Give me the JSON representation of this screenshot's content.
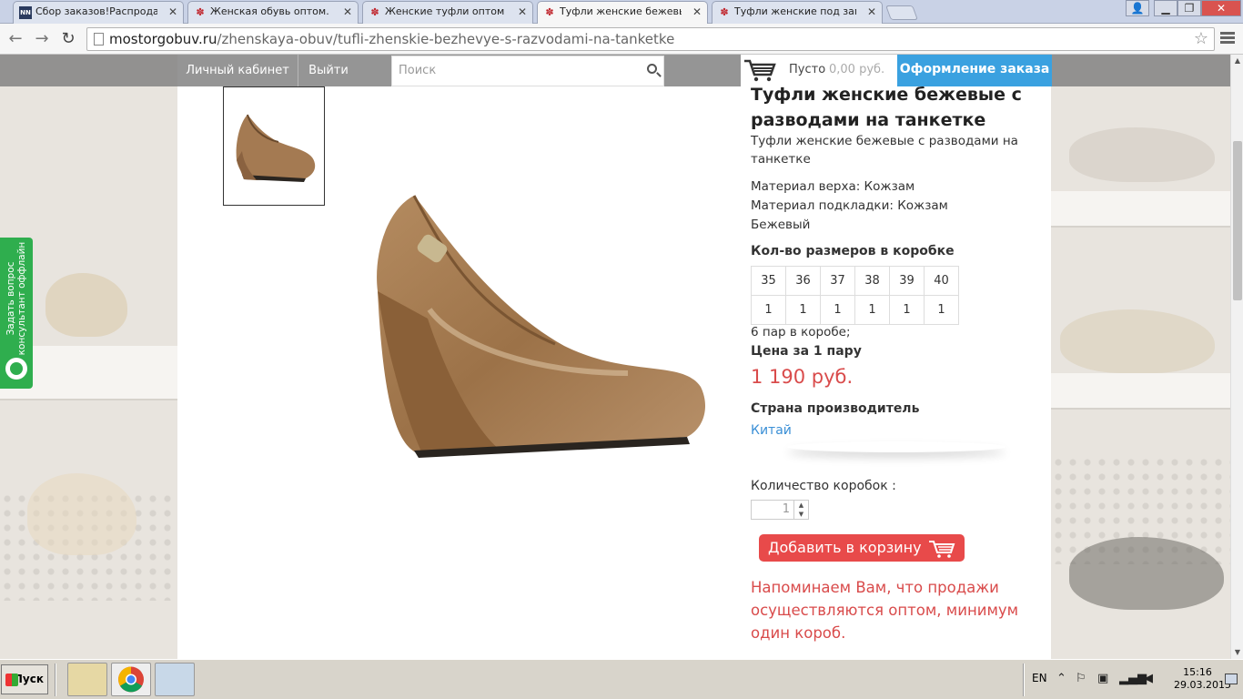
{
  "browser": {
    "tabs": [
      {
        "title": "Сбор заказов!Распродажа д",
        "favicon": "NN",
        "active": false
      },
      {
        "title": "Женская обувь оптом. Куп",
        "favicon": "flower",
        "active": false
      },
      {
        "title": "Женские туфли оптом | Бе",
        "favicon": "flower",
        "active": false
      },
      {
        "title": "Туфли женские бежевые с",
        "favicon": "flower",
        "active": true
      },
      {
        "title": "Туфли женские под замшу",
        "favicon": "flower",
        "active": false
      }
    ],
    "url_domain": "mostorgobuv.ru",
    "url_path": "/zhenskaya-obuv/tufli-zhenskie-bezhevye-s-razvodami-na-tanketke"
  },
  "sitenav": {
    "account": "Личный кабинет",
    "logout": "Выйти",
    "search_placeholder": "Поиск",
    "cart_status": "Пусто",
    "cart_sum": "0,00 руб.",
    "checkout": "Оформление заказа"
  },
  "product": {
    "title": "Туфли женские бежевые с разводами на танкетке",
    "description": "Туфли женские бежевые с разводами на танкетке",
    "material_top": "Материал верха: Кожзам",
    "material_lining": "Материал подкладки: Кожзам",
    "color": "Бежевый",
    "sizes_heading": "Кол-во размеров в коробке",
    "sizes": [
      "35",
      "36",
      "37",
      "38",
      "39",
      "40"
    ],
    "size_counts": [
      "1",
      "1",
      "1",
      "1",
      "1",
      "1"
    ],
    "pairs_in_box": "6 пар в коробе;",
    "price_heading": "Цена за 1 пару",
    "price": "1 190 руб.",
    "country_heading": "Страна производитель",
    "country": "Китай",
    "qty_label": "Количество коробок :",
    "qty_value": "1",
    "add_to_cart": "Добавить в корзину",
    "notice": "Напоминаем Вам, что продажи осуществляются оптом, минимум один короб."
  },
  "widget": {
    "line1": "Задать вопрос",
    "line2": "консультант оффлайн"
  },
  "taskbar": {
    "start": "Пуск",
    "lang": "EN",
    "time": "15:16",
    "date": "29.03.2015"
  },
  "colors": {
    "checkout_bg": "#3aa1e0",
    "price": "#d94b4b",
    "add_to_cart_bg": "#e84a4a",
    "widget_bg": "#2fae4e",
    "link": "#3a8fd6"
  }
}
